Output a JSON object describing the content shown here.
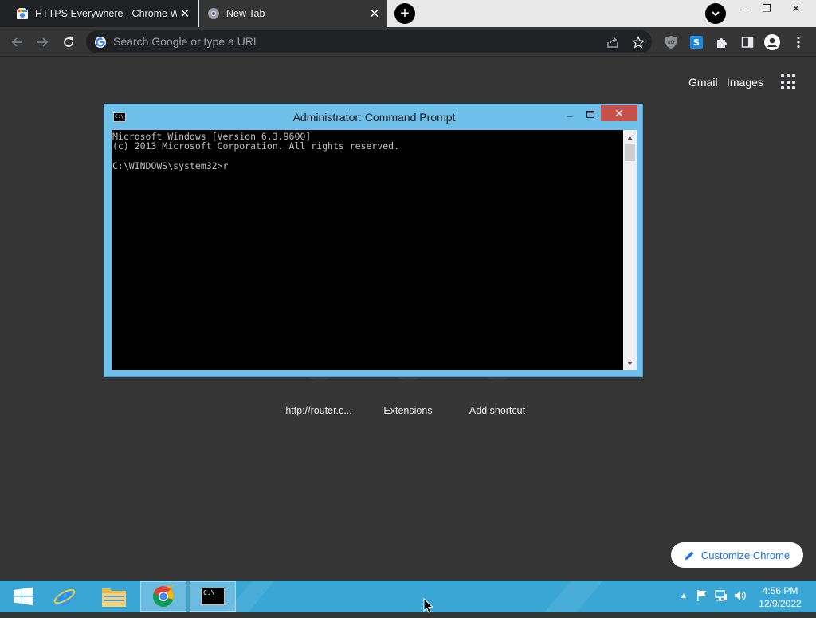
{
  "browser": {
    "tabs": [
      {
        "title": "HTTPS Everywhere - Chrome Web Store",
        "active": false,
        "icon": "chrome-web-store-icon"
      },
      {
        "title": "New Tab",
        "active": true,
        "icon": "chrome-icon"
      }
    ],
    "new_tab_symbol": "+",
    "omnibox_placeholder": "Search Google or type a URL",
    "window_controls": {
      "minimize": "–",
      "restore": "❐",
      "close": "✕"
    }
  },
  "ntp": {
    "gmail": "Gmail",
    "images": "Images",
    "shortcuts": [
      {
        "label": "http://router.c..."
      },
      {
        "label": "Extensions"
      },
      {
        "label": "Add shortcut"
      }
    ],
    "customize": "Customize Chrome"
  },
  "cmd": {
    "title": "Administrator: Command Prompt",
    "icon_text": "C:\\_",
    "console_text": "Microsoft Windows [Version 6.3.9600]\n(c) 2013 Microsoft Corporation. All rights reserved.\n\nC:\\WINDOWS\\system32>r",
    "minimize": "–",
    "close": "✕"
  },
  "taskbar": {
    "time": "4:56 PM",
    "date": "12/9/2022",
    "cmd_icon_text": "C:\\_"
  },
  "colors": {
    "taskbar": "#3aa6d6",
    "cmd_frame": "#6ec0ea",
    "ntp_bg": "#353535",
    "link_blue": "#1a73e8"
  }
}
